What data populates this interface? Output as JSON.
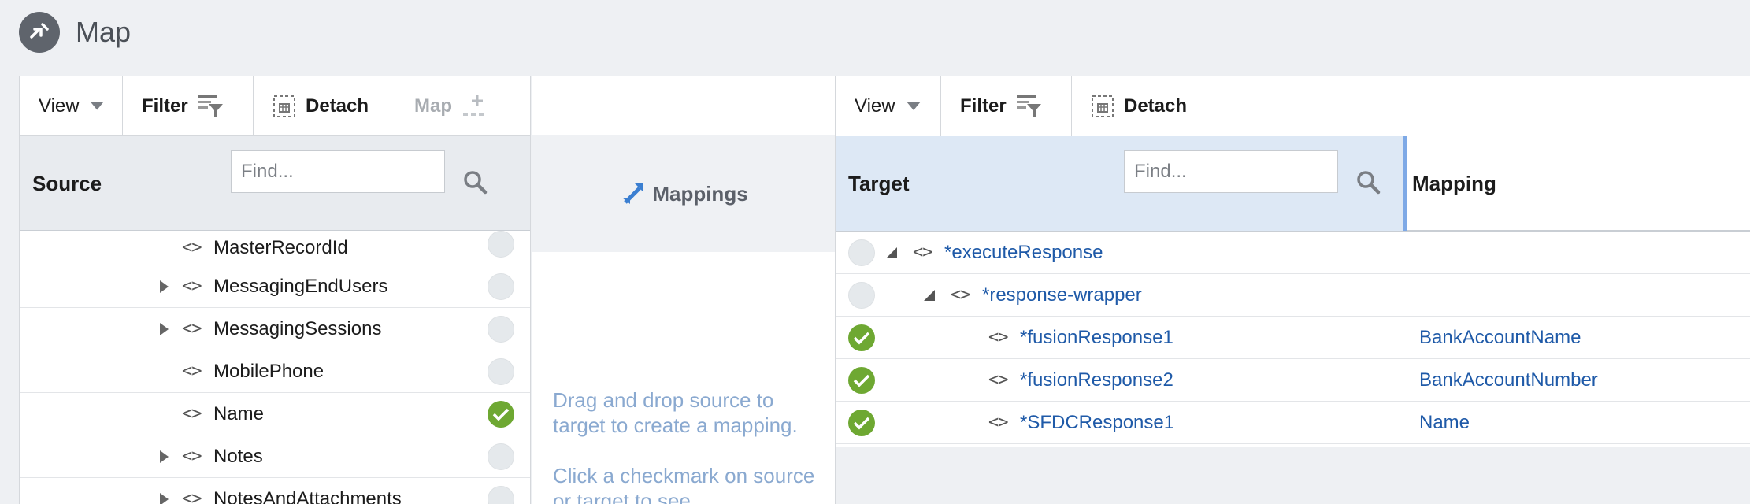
{
  "page": {
    "title": "Map"
  },
  "source": {
    "toolbar": {
      "view": "View",
      "filter": "Filter",
      "detach": "Detach",
      "map": "Map"
    },
    "header": "Source",
    "find_placeholder": "Find...",
    "rows": [
      {
        "label": "MasterRecordId"
      },
      {
        "label": "MessagingEndUsers"
      },
      {
        "label": "MessagingSessions"
      },
      {
        "label": "MobilePhone"
      },
      {
        "label": "Name"
      },
      {
        "label": "Notes"
      },
      {
        "label": "NotesAndAttachments"
      }
    ]
  },
  "middle": {
    "title": "Mappings",
    "hint1": "Drag and drop source to target to create a mapping.",
    "hint2": "Click a checkmark on source or target to see"
  },
  "target": {
    "toolbar": {
      "view": "View",
      "filter": "Filter",
      "detach": "Detach"
    },
    "header": "Target",
    "mapping_header": "Mapping",
    "find_placeholder": "Find...",
    "rows": [
      {
        "label": "*executeResponse",
        "mapping": ""
      },
      {
        "label": "*response-wrapper",
        "mapping": ""
      },
      {
        "label": "*fusionResponse1",
        "mapping": "BankAccountName"
      },
      {
        "label": "*fusionResponse2",
        "mapping": "BankAccountNumber"
      },
      {
        "label": "*SFDCResponse1",
        "mapping": "Name"
      }
    ]
  },
  "colors": {
    "accent_green": "#6ea832",
    "link_blue": "#1f5aa8",
    "hint_blue": "#8aa9d0"
  },
  "icons": [
    "map-icon",
    "dropdown-icon",
    "filter-icon",
    "detach-icon",
    "add-map-icon",
    "search-icon",
    "mappings-icon",
    "expand-icon",
    "collapse-icon",
    "element-icon",
    "check-icon"
  ]
}
